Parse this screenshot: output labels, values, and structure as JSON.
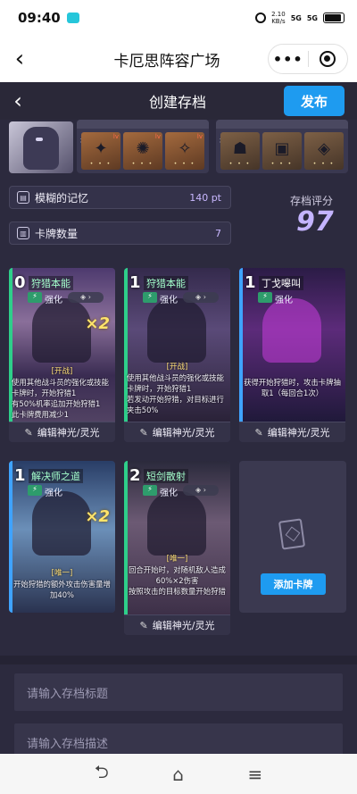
{
  "status_bar": {
    "time": "09:40",
    "net_speed": "2.10",
    "net_unit": "KB/s",
    "signal_1": "5G",
    "signal_2": "5G"
  },
  "mini_program": {
    "title": "卡厄思阵容广场",
    "more_glyph": "•••"
  },
  "page_header": {
    "title": "创建存档",
    "publish_label": "发布",
    "back_glyph": "‹"
  },
  "loadout": {
    "group1_slots": [
      {
        "glyph": "✦",
        "level": "lv"
      },
      {
        "glyph": "✺",
        "level": "lv"
      },
      {
        "glyph": "✧",
        "level": "lv"
      }
    ],
    "group2_slots": [
      {
        "glyph": "☗"
      },
      {
        "glyph": "▣"
      },
      {
        "glyph": "◈"
      }
    ],
    "slot_dots": "• • •",
    "swap_glyph": "⇄"
  },
  "stats": [
    {
      "label": "模糊的记忆",
      "value": "140 pt",
      "icon": "memory-icon"
    },
    {
      "label": "卡牌数量",
      "value": "7",
      "icon": "card-count-icon"
    }
  ],
  "score": {
    "label": "存档评分",
    "value": "97"
  },
  "edit_label": "编辑神光/灵光",
  "cards": [
    {
      "cost": "0",
      "name": "狩猎本能",
      "type": "强化",
      "multiplier": "×2",
      "keyword": "[开战]",
      "desc": "使用其他战斗员的强化或技能卡牌时，开始狩猎1",
      "extra": "有50%机率追加开始狩猎1",
      "note": "此卡牌费用减少1"
    },
    {
      "cost": "1",
      "name": "狩猎本能",
      "type": "强化",
      "keyword": "[开战]",
      "desc": "使用其他战斗员的强化或技能卡牌时，开始狩猎1",
      "extra": "若发动开始狩猎，对目标进行夹击50%"
    },
    {
      "cost": "1",
      "name": "丁戈嗥叫",
      "type": "强化",
      "desc": "获得开始狩猎时，攻击卡牌抽取1（每回合1次）"
    },
    {
      "cost": "1",
      "name": "解决师之道",
      "type": "强化",
      "multiplier": "×2",
      "keyword": "[唯一]",
      "desc": "开始狩猎的额外攻击伤害量增加40%"
    },
    {
      "cost": "2",
      "name": "短剑散射",
      "type": "强化",
      "keyword": "[唯一]",
      "desc": "回合开始时，对随机敌人造成60%×2伤害",
      "extra": "按照攻击的目标数量开始狩猎"
    }
  ],
  "add_card_label": "添加卡牌",
  "inputs": {
    "title_placeholder": "请输入存档标题",
    "desc_placeholder": "请输入存档描述"
  },
  "nav": {
    "back": "⮌",
    "home": "⌂",
    "menu": "≡"
  }
}
